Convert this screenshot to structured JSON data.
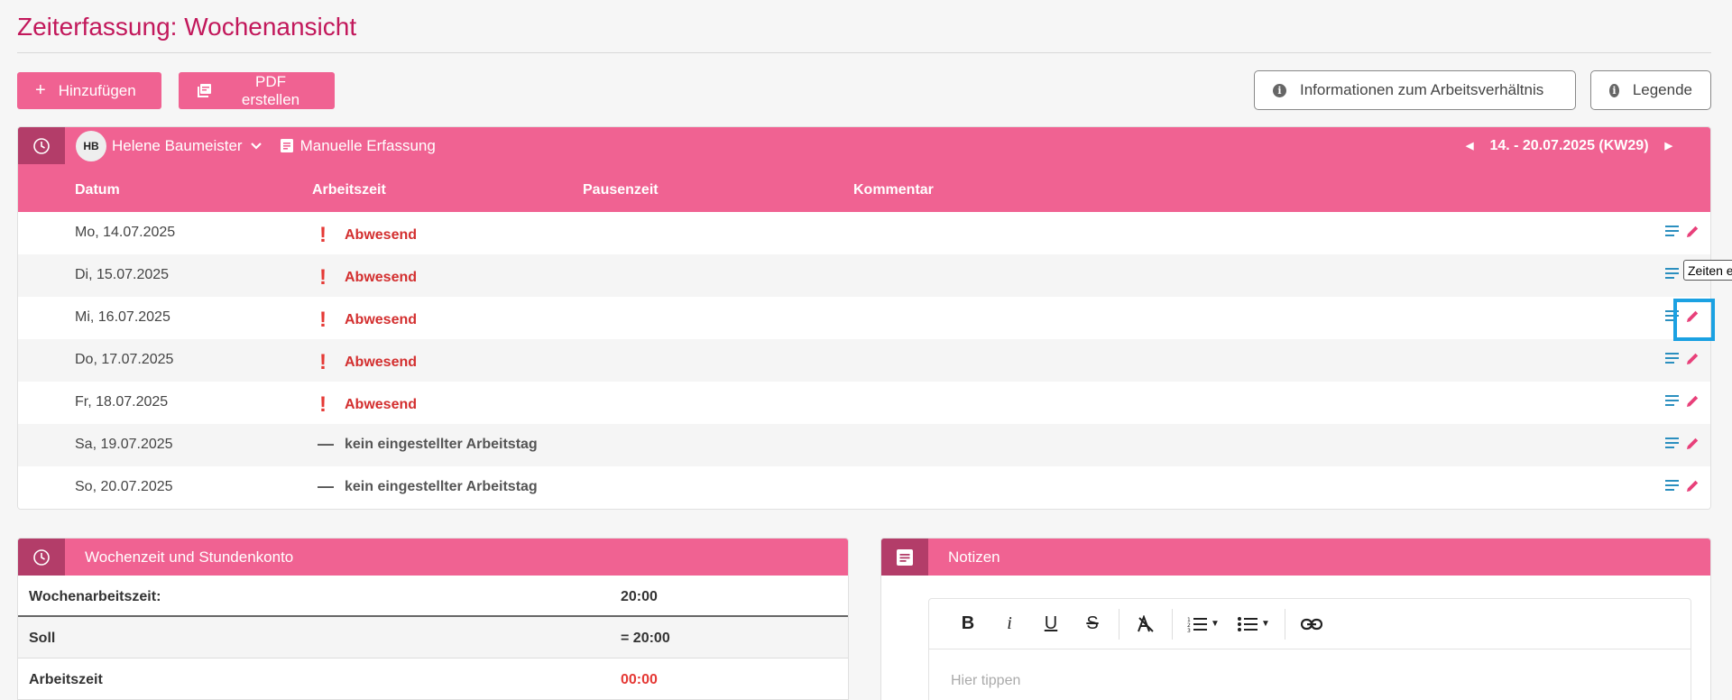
{
  "page": {
    "title": "Zeiterfassung: Wochenansicht"
  },
  "actions": {
    "add_label": "Hinzufügen",
    "pdf_label": "PDF erstellen",
    "employment_info_label": "Informationen zum Arbeitsverhältnis",
    "legend_label": "Legende"
  },
  "week": {
    "user_initials": "HB",
    "user_name": "Helene Baumeister",
    "mode_label": "Manuelle Erfassung",
    "range_label": "14. - 20.07.2025 (KW29)",
    "columns": {
      "date": "Datum",
      "worktime": "Arbeitszeit",
      "break": "Pausenzeit",
      "comment": "Kommentar"
    },
    "rows": [
      {
        "date": "Mo, 14.07.2025",
        "status": "Abwesend",
        "type": "absent"
      },
      {
        "date": "Di, 15.07.2025",
        "status": "Abwesend",
        "type": "absent"
      },
      {
        "date": "Mi, 16.07.2025",
        "status": "Abwesend",
        "type": "absent"
      },
      {
        "date": "Do, 17.07.2025",
        "status": "Abwesend",
        "type": "absent"
      },
      {
        "date": "Fr, 18.07.2025",
        "status": "Abwesend",
        "type": "absent"
      },
      {
        "date": "Sa, 19.07.2025",
        "status": "kein eingestellter Arbeitstag",
        "type": "off"
      },
      {
        "date": "So, 20.07.2025",
        "status": "kein eingestellter Arbeitstag",
        "type": "off"
      }
    ],
    "absent_marker": "!",
    "off_marker": "—",
    "tooltip": "Zeiten e"
  },
  "hours": {
    "title": "Wochenzeit und Stundenkonto",
    "rows": [
      {
        "label": "Wochenarbeitszeit:",
        "value": "20:00"
      },
      {
        "label": "Soll",
        "value": "= 20:00"
      },
      {
        "label": "Arbeitszeit",
        "value": "00:00"
      }
    ]
  },
  "notes": {
    "title": "Notizen",
    "placeholder": "Hier tippen",
    "toolbar": {
      "bold": "B",
      "italic": "i",
      "underline": "U",
      "strike": "S"
    }
  },
  "colors": {
    "accent": "#f06292",
    "accent_dark": "#b33d69",
    "title": "#c2185b",
    "error": "#d32f2f",
    "highlight": "#1ba1e2"
  }
}
